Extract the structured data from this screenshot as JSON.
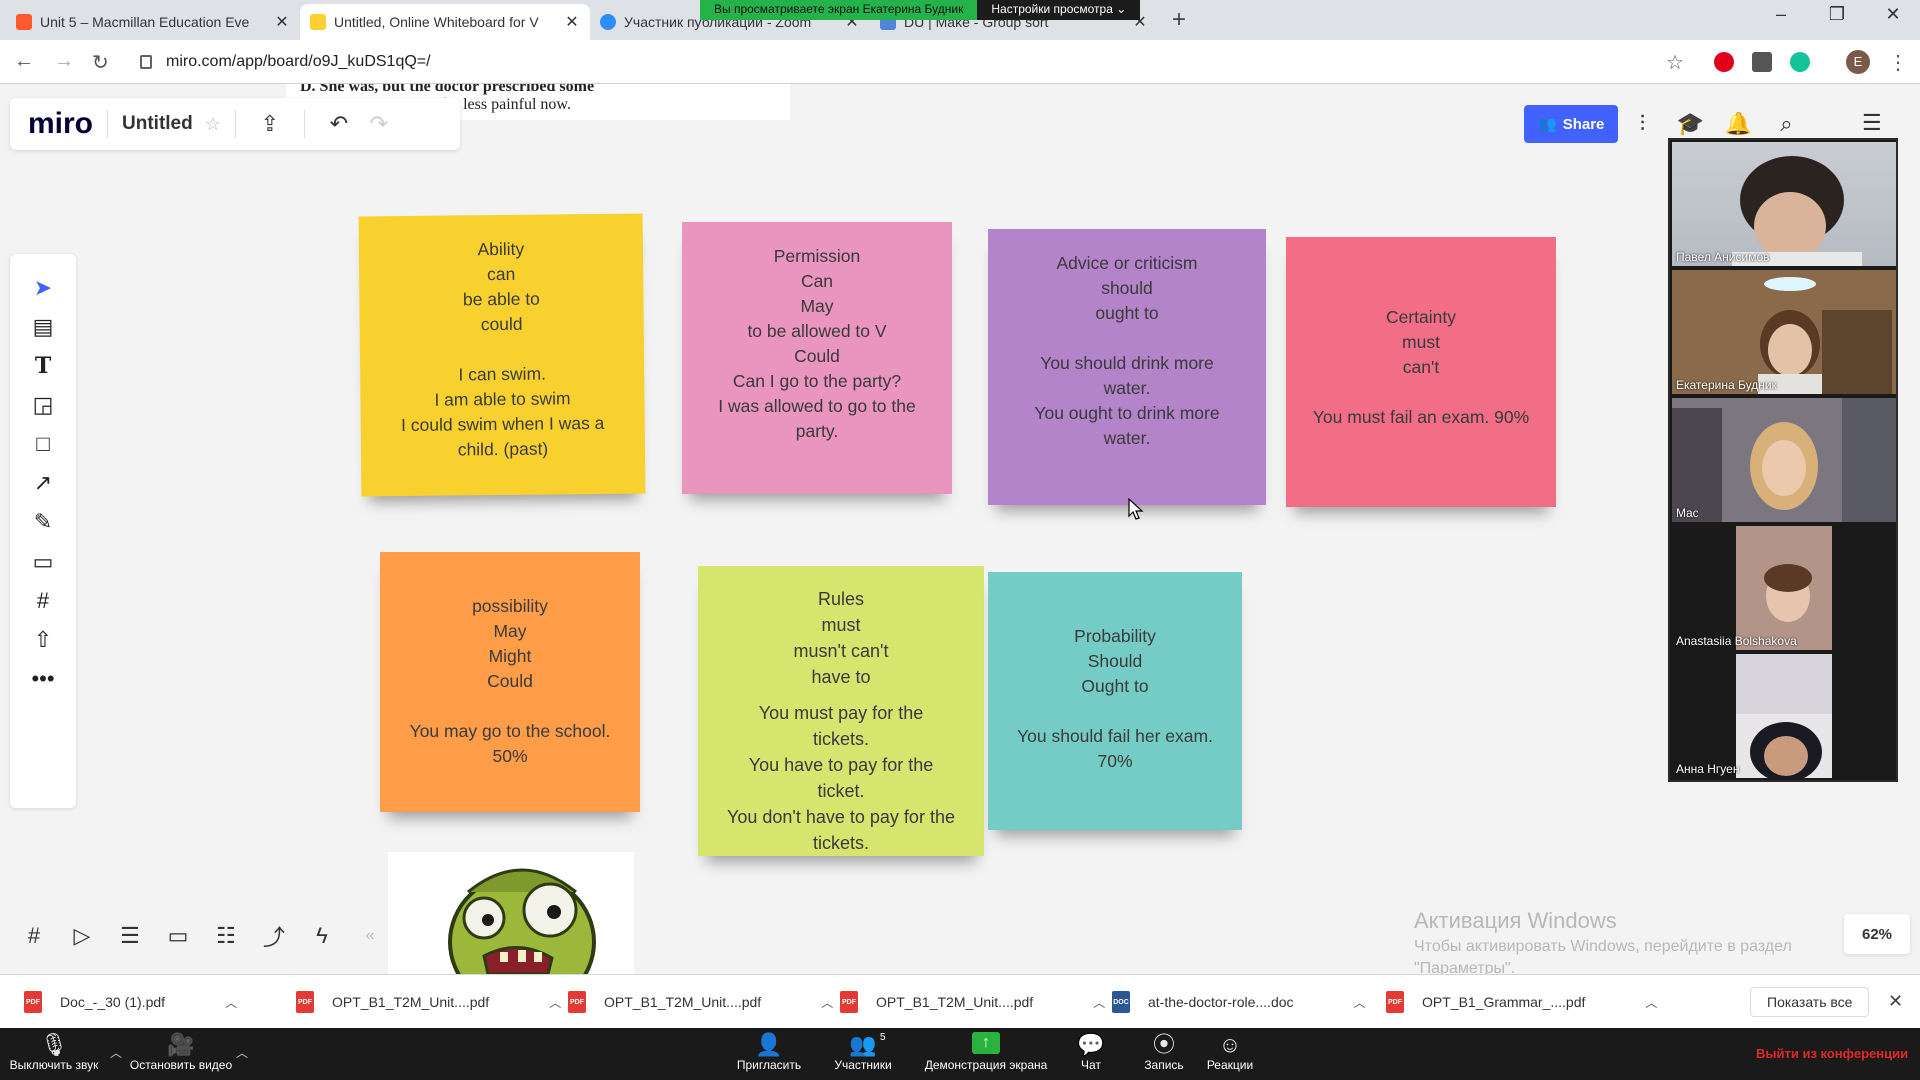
{
  "browser": {
    "tabs": [
      {
        "title": "Unit 5 – Macmillan Education Eve",
        "favicon_color": "#ff5a2e"
      },
      {
        "title": "Untitled, Online Whiteboard for V",
        "favicon_color": "#ffd02f"
      },
      {
        "title": "Участник публикации - Zoom",
        "favicon_color": "#2d8cff"
      },
      {
        "title": "DU | Make - Group sort",
        "favicon_color": "#4f86d8"
      }
    ],
    "share_banner": "Вы просматриваете экран Екатерина Будник",
    "view_options": "Настройки просмотра ⌄",
    "url": "miro.com/app/board/o9J_kuDS1qQ=/",
    "profile_initial": "E"
  },
  "doc_snippet": {
    "line1": "D. She was, but the doctor prescribed some",
    "line2": "n ________________ be less painful now."
  },
  "miro": {
    "logo": "miro",
    "board_title": "Untitled",
    "share_label": "Share",
    "zoom_level": "62%",
    "left_tools": [
      "select-tool",
      "templates-tool",
      "text-tool",
      "sticky-note-tool",
      "shape-tool",
      "connection-line-tool",
      "pen-tool",
      "comment-tool",
      "frame-tool",
      "upload-tool",
      "more-tools"
    ],
    "bottom_tools": [
      "frames-icon",
      "presentation-icon",
      "comments-icon",
      "cards-icon",
      "kanban-icon",
      "share-screen-icon",
      "lightning-icon"
    ]
  },
  "stickies": [
    {
      "id": "ability",
      "color": "#f8d12f",
      "lines": [
        "Ability",
        "can",
        "be able to",
        "could",
        "",
        "I can swim.",
        "I am able to swim",
        "I could swim when I was a",
        "child. (past)"
      ]
    },
    {
      "id": "permission",
      "color": "#ea94c0",
      "lines": [
        "Permission",
        "Can",
        "May",
        "to be allowed to V",
        "Could",
        "Can I go to the party?",
        "I was allowed to go to the",
        "party."
      ]
    },
    {
      "id": "advice",
      "color": "#b384c9",
      "lines": [
        "Advice or criticism",
        "should",
        "ought to",
        "",
        "You should drink more",
        "water.",
        "You ought to drink more",
        "water."
      ]
    },
    {
      "id": "certainty",
      "color": "#f16e86",
      "lines": [
        "Certainty",
        "must",
        "can't",
        "",
        "You must fail an exam. 90%"
      ]
    },
    {
      "id": "possibility",
      "color": "#ff9d48",
      "lines": [
        "possibility",
        "May",
        "Might",
        "Could",
        "",
        "You may go to the school.",
        "50%"
      ]
    },
    {
      "id": "rules",
      "color": "#d5e56e",
      "lines": [
        "Rules",
        "must",
        "musn't can't",
        "have to",
        "",
        "You must pay for the",
        "tickets.",
        "You have to pay for the",
        "ticket.",
        "You don't have to pay for the tickets."
      ]
    },
    {
      "id": "probability",
      "color": "#75ccc7",
      "lines": [
        "Probability",
        "Should",
        "Ought to",
        "",
        "You should fail her exam.",
        "70%"
      ]
    }
  ],
  "windows_activation": {
    "title": "Активация Windows",
    "line1": "Чтобы активировать Windows, перейдите в раздел",
    "line2": "\"Параметры\"."
  },
  "participants": [
    {
      "name": "Павел Анисимов"
    },
    {
      "name": "Екатерина Будник"
    },
    {
      "name": "Mac"
    },
    {
      "name": "Anastasiia Bolshakova"
    },
    {
      "name": "Анна Нгуен"
    }
  ],
  "downloads": {
    "items": [
      {
        "name": "Doc_-_30 (1).pdf",
        "type": "PDF"
      },
      {
        "name": "OPT_B1_T2M_Unit....pdf",
        "type": "PDF"
      },
      {
        "name": "OPT_B1_T2M_Unit....pdf",
        "type": "PDF"
      },
      {
        "name": "OPT_B1_T2M_Unit....pdf",
        "type": "PDF"
      },
      {
        "name": "at-the-doctor-role....doc",
        "type": "DOC"
      },
      {
        "name": "OPT_B1_Grammar_....pdf",
        "type": "PDF"
      }
    ],
    "show_all": "Показать все"
  },
  "zoom_controls": {
    "mute": "Выключить звук",
    "stop_video": "Остановить видео",
    "invite": "Пригласить",
    "participants": "Участники",
    "participants_count": "5",
    "share_screen": "Демонстрация экрана",
    "chat": "Чат",
    "record": "Запись",
    "reactions": "Реакции",
    "leave": "Выйти из конференции"
  }
}
